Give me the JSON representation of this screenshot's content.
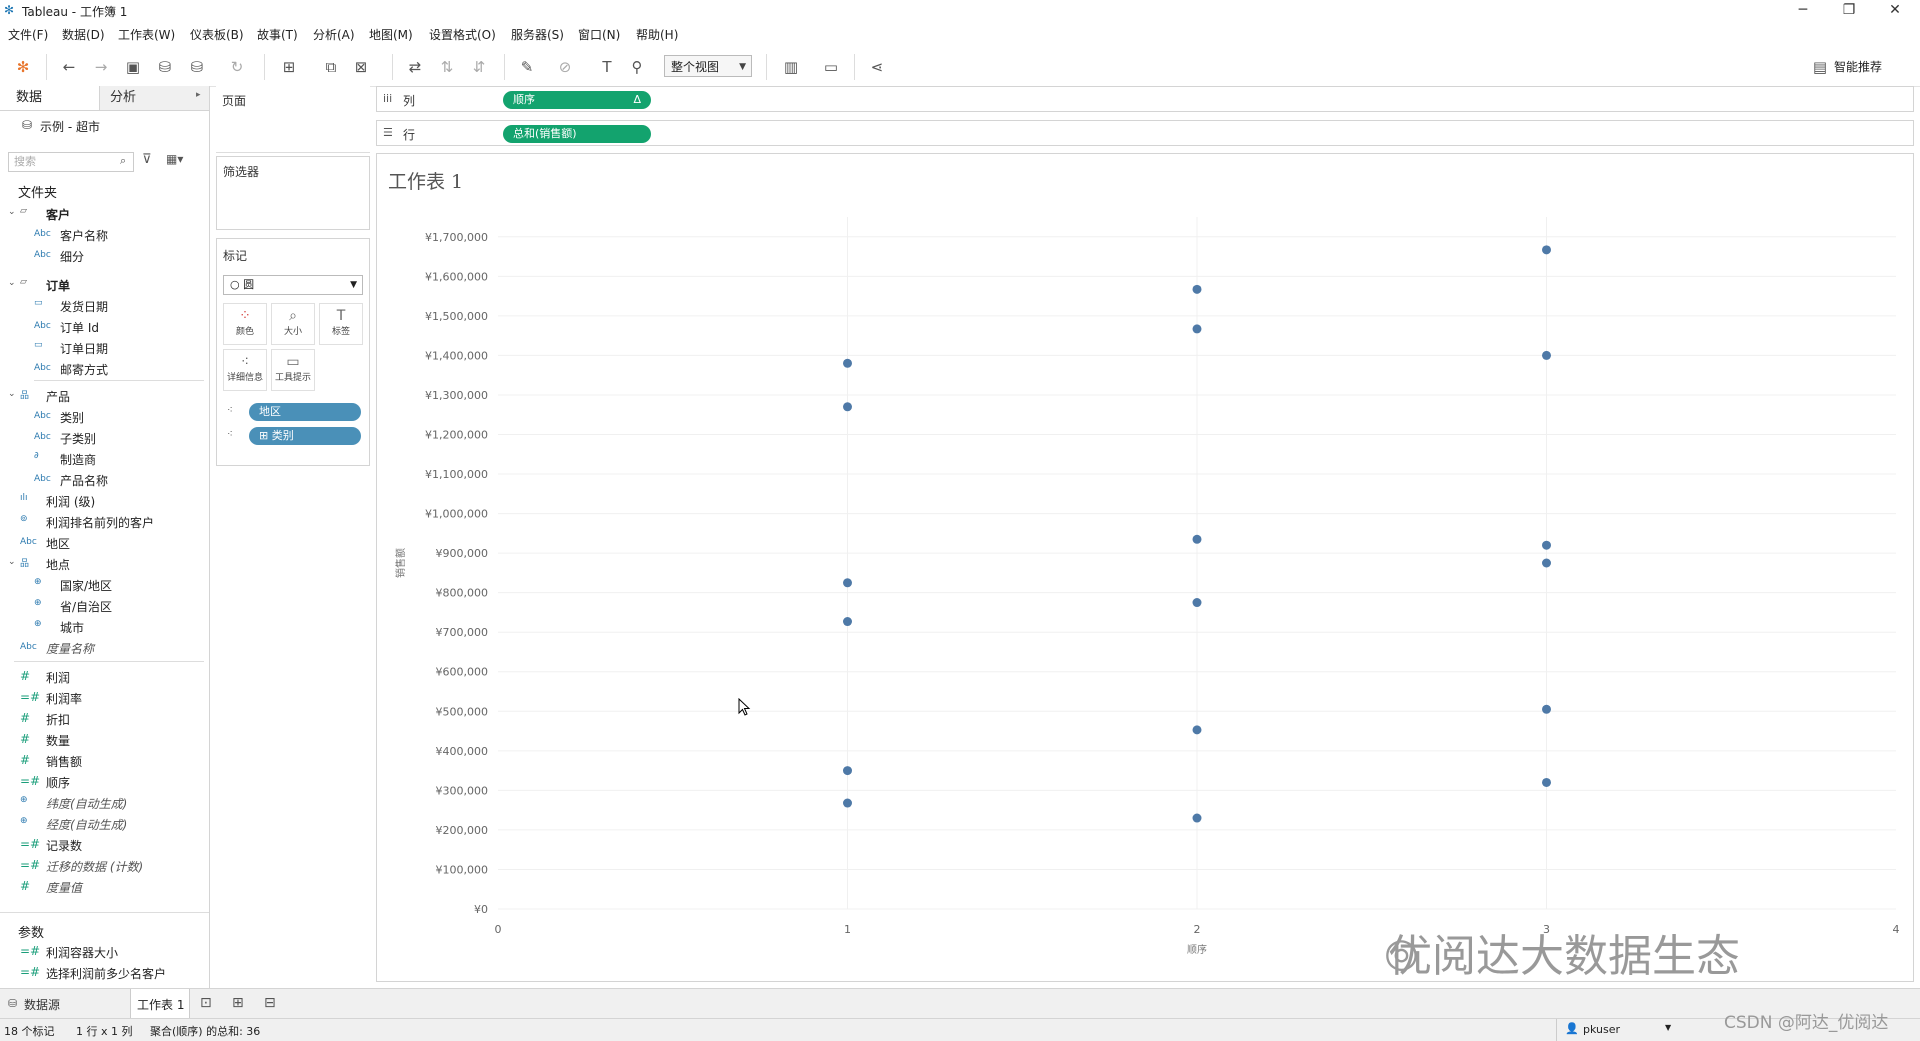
{
  "window": {
    "title": "Tableau - 工作簿 1",
    "minimize": "─",
    "maximize": "❐",
    "close": "✕"
  },
  "menu": [
    "文件(F)",
    "数据(D)",
    "工作表(W)",
    "仪表板(B)",
    "故事(T)",
    "分析(A)",
    "地图(M)",
    "设置格式(O)",
    "服务器(S)",
    "窗口(N)",
    "帮助(H)"
  ],
  "toolbar": {
    "view_select": "整个视图",
    "smart_recommend": "智能推荐"
  },
  "left_pane": {
    "tab_data": "数据",
    "tab_analysis": "分析",
    "datasource": "示例 - 超市",
    "search_placeholder": "搜索",
    "folder_header": "文件夹",
    "params_header": "参数",
    "items": [
      {
        "type": "folder",
        "label": "客户",
        "icon": "▱",
        "bold": true
      },
      {
        "type": "abc",
        "label": "客户名称",
        "icon": "Abc",
        "indent": 1
      },
      {
        "type": "abc",
        "label": "细分",
        "icon": "Abc",
        "indent": 1
      },
      {
        "type": "folder",
        "label": "订单",
        "icon": "▱",
        "bold": true
      },
      {
        "type": "date",
        "label": "发货日期",
        "icon": "▭",
        "indent": 1
      },
      {
        "type": "abc",
        "label": "订单 Id",
        "icon": "Abc",
        "indent": 1
      },
      {
        "type": "date",
        "label": "订单日期",
        "icon": "▭",
        "indent": 1
      },
      {
        "type": "abc",
        "label": "邮寄方式",
        "icon": "Abc",
        "indent": 1
      },
      {
        "type": "hier",
        "label": "产品",
        "icon": "品"
      },
      {
        "type": "abc",
        "label": "类别",
        "icon": "Abc",
        "indent": 1
      },
      {
        "type": "abc",
        "label": "子类别",
        "icon": "Abc",
        "indent": 1
      },
      {
        "type": "clip",
        "label": "制造商",
        "icon": "∂",
        "indent": 1
      },
      {
        "type": "abc",
        "label": "产品名称",
        "icon": "Abc",
        "indent": 1
      },
      {
        "type": "bin",
        "label": "利润 (级)",
        "icon": "ılı"
      },
      {
        "type": "set",
        "label": "利润排名前列的客户",
        "icon": "⊚"
      },
      {
        "type": "abc",
        "label": "地区",
        "icon": "Abc"
      },
      {
        "type": "hier",
        "label": "地点",
        "icon": "品"
      },
      {
        "type": "geo",
        "label": "国家/地区",
        "icon": "⊕",
        "indent": 1
      },
      {
        "type": "geo",
        "label": "省/自治区",
        "icon": "⊕",
        "indent": 1
      },
      {
        "type": "geo",
        "label": "城市",
        "icon": "⊕",
        "indent": 1
      },
      {
        "type": "abc",
        "label": "度量名称",
        "icon": "Abc",
        "italic": true
      },
      {
        "type": "measure",
        "label": "利润",
        "icon": "#"
      },
      {
        "type": "measure",
        "label": "利润率",
        "icon": "=#"
      },
      {
        "type": "measure",
        "label": "折扣",
        "icon": "#"
      },
      {
        "type": "measure",
        "label": "数量",
        "icon": "#"
      },
      {
        "type": "measure",
        "label": "销售额",
        "icon": "#"
      },
      {
        "type": "measure",
        "label": "顺序",
        "icon": "=#"
      },
      {
        "type": "geo",
        "label": "纬度(自动生成)",
        "icon": "⊕",
        "italic": true
      },
      {
        "type": "geo",
        "label": "经度(自动生成)",
        "icon": "⊕",
        "italic": true
      },
      {
        "type": "measure",
        "label": "记录数",
        "icon": "=#"
      },
      {
        "type": "measure",
        "label": "迁移的数据 (计数)",
        "icon": "=#",
        "italic": true
      },
      {
        "type": "measure",
        "label": "度量值",
        "icon": "#",
        "italic": true
      }
    ],
    "params": [
      {
        "label": "利润容器大小",
        "icon": "=#"
      },
      {
        "label": "选择利润前多少名客户",
        "icon": "=#"
      }
    ]
  },
  "cards": {
    "pages": "页面",
    "filters": "筛选器",
    "marks": "标记",
    "mark_type": "圆",
    "mark_buttons": [
      {
        "label": "颜色",
        "glyph": "⁘"
      },
      {
        "label": "大小",
        "glyph": "⌕"
      },
      {
        "label": "标签",
        "glyph": "T"
      },
      {
        "label": "详细信息",
        "glyph": "⁖"
      },
      {
        "label": "工具提示",
        "glyph": "▭"
      }
    ],
    "mark_pills": [
      {
        "label": "地区",
        "prefix": ""
      },
      {
        "label": "类别",
        "prefix": "⊞"
      }
    ]
  },
  "shelves": {
    "columns_label": "列",
    "rows_label": "行",
    "columns_pill": "顺序",
    "columns_pill_delta": "Δ",
    "rows_pill": "总和(销售额)"
  },
  "sheet": {
    "title": "工作表 1"
  },
  "chart_data": {
    "type": "scatter",
    "xlabel": "顺序",
    "ylabel": "销售额",
    "xlim": [
      0,
      4
    ],
    "ylim": [
      0,
      1750000
    ],
    "x_ticks": [
      "0",
      "1",
      "2",
      "3",
      "4"
    ],
    "y_ticks": [
      "¥0",
      "¥100,000",
      "¥200,000",
      "¥300,000",
      "¥400,000",
      "¥500,000",
      "¥600,000",
      "¥700,000",
      "¥800,000",
      "¥900,000",
      "¥1,000,000",
      "¥1,100,000",
      "¥1,200,000",
      "¥1,300,000",
      "¥1,400,000",
      "¥1,500,000",
      "¥1,600,000",
      "¥1,700,000"
    ],
    "y_tick_values": [
      0,
      100000,
      200000,
      300000,
      400000,
      500000,
      600000,
      700000,
      800000,
      900000,
      1000000,
      1100000,
      1200000,
      1300000,
      1400000,
      1500000,
      1600000,
      1700000
    ],
    "points": [
      {
        "x": 1,
        "y": 1380000
      },
      {
        "x": 1,
        "y": 1270000
      },
      {
        "x": 1,
        "y": 825000
      },
      {
        "x": 1,
        "y": 727000
      },
      {
        "x": 1,
        "y": 350000
      },
      {
        "x": 1,
        "y": 268000
      },
      {
        "x": 2,
        "y": 1567000
      },
      {
        "x": 2,
        "y": 1467000
      },
      {
        "x": 2,
        "y": 935000
      },
      {
        "x": 2,
        "y": 775000
      },
      {
        "x": 2,
        "y": 453000
      },
      {
        "x": 2,
        "y": 230000
      },
      {
        "x": 3,
        "y": 1667000
      },
      {
        "x": 3,
        "y": 1400000
      },
      {
        "x": 3,
        "y": 920000
      },
      {
        "x": 3,
        "y": 875000
      },
      {
        "x": 3,
        "y": 505000
      },
      {
        "x": 3,
        "y": 320000
      }
    ],
    "grid": true,
    "point_color": "#4e79a7"
  },
  "bottom": {
    "datasource_tab": "数据源",
    "sheet_tab": "工作表 1"
  },
  "status": {
    "marks": "18 个标记",
    "rowscols": "1 行 x 1 列",
    "sum": "聚合(顺序) 的总和: 36",
    "user": "pkuser"
  },
  "watermark": "优阅达大数据生态",
  "csdn": "CSDN @阿达_优阅达"
}
